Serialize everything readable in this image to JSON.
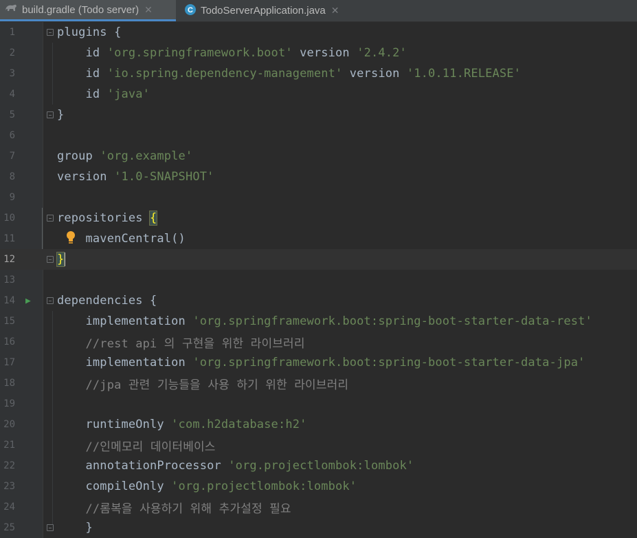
{
  "tabs": [
    {
      "label": "build.gradle (Todo server)",
      "icon": "gradle-elephant-icon",
      "active": true
    },
    {
      "label": "TodoServerApplication.java",
      "icon": "java-class-icon",
      "active": false
    }
  ],
  "editor": {
    "current_line": 12,
    "lines": [
      {
        "n": "1",
        "text": "plugins {"
      },
      {
        "n": "2",
        "text": "    id 'org.springframework.boot' version '2.4.2'"
      },
      {
        "n": "3",
        "text": "    id 'io.spring.dependency-management' version '1.0.11.RELEASE'"
      },
      {
        "n": "4",
        "text": "    id 'java'"
      },
      {
        "n": "5",
        "text": "}"
      },
      {
        "n": "6",
        "text": ""
      },
      {
        "n": "7",
        "text": "group 'org.example'"
      },
      {
        "n": "8",
        "text": "version '1.0-SNAPSHOT'"
      },
      {
        "n": "9",
        "text": ""
      },
      {
        "n": "10",
        "text": "repositories {"
      },
      {
        "n": "11",
        "text": "    mavenCentral()"
      },
      {
        "n": "12",
        "text": "}"
      },
      {
        "n": "13",
        "text": ""
      },
      {
        "n": "14",
        "text": "dependencies {"
      },
      {
        "n": "15",
        "text": "    implementation 'org.springframework.boot:spring-boot-starter-data-rest'"
      },
      {
        "n": "16",
        "text": "    //rest api 의 구현을 위한 라이브러리"
      },
      {
        "n": "17",
        "text": "    implementation 'org.springframework.boot:spring-boot-starter-data-jpa'"
      },
      {
        "n": "18",
        "text": "    //jpa 관련 기능들을 사용 하기 위한 라이브러리"
      },
      {
        "n": "19",
        "text": ""
      },
      {
        "n": "20",
        "text": "    runtimeOnly 'com.h2database:h2'"
      },
      {
        "n": "21",
        "text": "    //인메모리 데이터베이스"
      },
      {
        "n": "22",
        "text": "    annotationProcessor 'org.projectlombok:lombok'"
      },
      {
        "n": "23",
        "text": "    compileOnly 'org.projectlombok:lombok'"
      },
      {
        "n": "24",
        "text": "    //롬복을 사용하기 위해 추가설정 필요"
      },
      {
        "n": "25",
        "text": "    }"
      }
    ]
  },
  "colors": {
    "background": "#2b2b2b",
    "gutter": "#313335",
    "string": "#6a8759",
    "comment": "#808080",
    "text": "#a9b7c6",
    "tab_active_underline": "#4a88c7"
  }
}
